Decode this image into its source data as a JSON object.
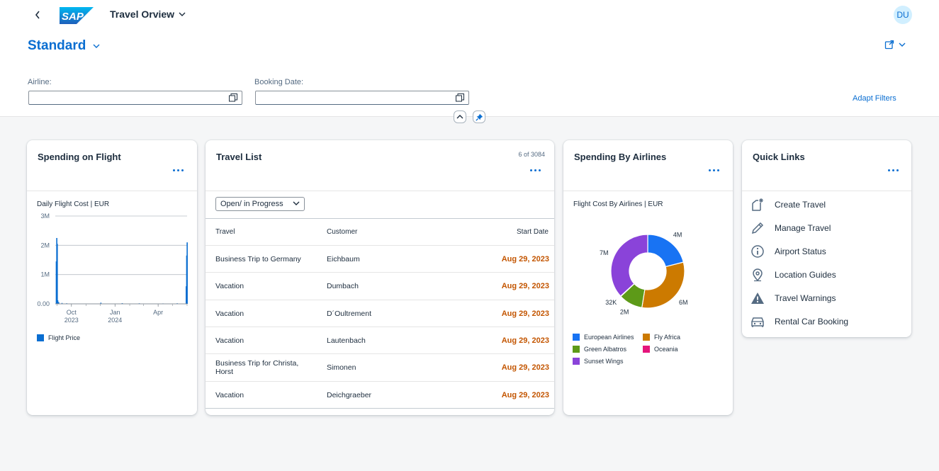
{
  "shell": {
    "logo_text": "SAP",
    "app_title": "Travel Orview",
    "user_initials": "DU"
  },
  "header": {
    "variant": "Standard",
    "filters": [
      {
        "label": "Airline:",
        "value": ""
      },
      {
        "label": "Booking Date:",
        "value": ""
      }
    ],
    "adapt_filters": "Adapt Filters"
  },
  "cards": {
    "spending_flight": {
      "title": "Spending on Flight",
      "subtitle": "Daily Flight Cost | EUR",
      "legend": "Flight Price",
      "color": "#0a6ed1"
    },
    "travel_list": {
      "title": "Travel List",
      "count": "6 of 3084",
      "filter": "Open/ in Progress",
      "columns": [
        "Travel",
        "Customer",
        "Start Date"
      ],
      "rows": [
        {
          "travel": "Business Trip to Germany",
          "customer": "Eichbaum",
          "date": "Aug 29, 2023"
        },
        {
          "travel": "Vacation",
          "customer": "Dumbach",
          "date": "Aug 29, 2023"
        },
        {
          "travel": "Vacation",
          "customer": "D´Oultrement",
          "date": "Aug 29, 2023"
        },
        {
          "travel": "Vacation",
          "customer": "Lautenbach",
          "date": "Aug 29, 2023"
        },
        {
          "travel": "Business Trip for Christa, Horst",
          "customer": "Simonen",
          "date": "Aug 29, 2023"
        },
        {
          "travel": "Vacation",
          "customer": "Deichgraeber",
          "date": "Aug 29, 2023"
        }
      ]
    },
    "spending_airlines": {
      "title": "Spending By Airlines",
      "subtitle": "Flight Cost By Airlines | EUR"
    },
    "quick_links": {
      "title": "Quick Links",
      "items": [
        {
          "label": "Create Travel",
          "icon": "create-travel-icon"
        },
        {
          "label": "Manage Travel",
          "icon": "pencil-icon"
        },
        {
          "label": "Airport Status",
          "icon": "info-icon"
        },
        {
          "label": "Location Guides",
          "icon": "location-icon"
        },
        {
          "label": "Travel Warnings",
          "icon": "warning-icon"
        },
        {
          "label": "Rental Car Booking",
          "icon": "car-icon"
        }
      ]
    }
  },
  "chart_data": [
    {
      "type": "bar",
      "title": "Daily Flight Cost | EUR",
      "series": [
        {
          "name": "Flight Price",
          "color": "#0a6ed1"
        }
      ],
      "y_ticks": [
        "0.00",
        "1M",
        "2M",
        "3M"
      ],
      "ylim": [
        0,
        3000000
      ],
      "x_ticks": [
        {
          "label": "Oct",
          "sub": "2023"
        },
        {
          "label": "Jan",
          "sub": "2024"
        },
        {
          "label": "Apr",
          "sub": ""
        }
      ],
      "bars": [
        {
          "x": "2023-08-29",
          "y": 1450000
        },
        {
          "x": "2023-08-30",
          "y": 2250000
        },
        {
          "x": "2023-08-31",
          "y": 2050000
        },
        {
          "x": "2023-09-01",
          "y": 120000
        },
        {
          "x": "2023-09-03",
          "y": 60000
        },
        {
          "x": "2023-09-10",
          "y": 30000
        },
        {
          "x": "2023-09-20",
          "y": 20000
        },
        {
          "x": "2023-12-01",
          "y": 40000
        },
        {
          "x": "2024-01-15",
          "y": 25000
        },
        {
          "x": "2024-02-20",
          "y": 20000
        },
        {
          "x": "2024-04-10",
          "y": 15000
        },
        {
          "x": "2024-05-10",
          "y": 20000
        },
        {
          "x": "2024-05-29",
          "y": 600000
        },
        {
          "x": "2024-05-30",
          "y": 1650000
        },
        {
          "x": "2024-05-31",
          "y": 2100000
        }
      ],
      "legend_position": "bottom-left",
      "grid": true
    },
    {
      "type": "pie",
      "subtype": "donut",
      "title": "Flight Cost By Airlines | EUR",
      "slices": [
        {
          "name": "European Airlines",
          "value": 4,
          "label": "4M",
          "color": "#1873f3"
        },
        {
          "name": "Fly Africa",
          "value": 6,
          "label": "6M",
          "color": "#cc7a00"
        },
        {
          "name": "Green Albatros",
          "value": 2,
          "label": "2M",
          "color": "#5d9a18"
        },
        {
          "name": "Oceania",
          "value": 0.032,
          "label": "32K",
          "color": "#e5157c"
        },
        {
          "name": "Sunset Wings",
          "value": 7,
          "label": "7M",
          "color": "#8a43d9"
        }
      ],
      "legend_position": "bottom"
    }
  ]
}
